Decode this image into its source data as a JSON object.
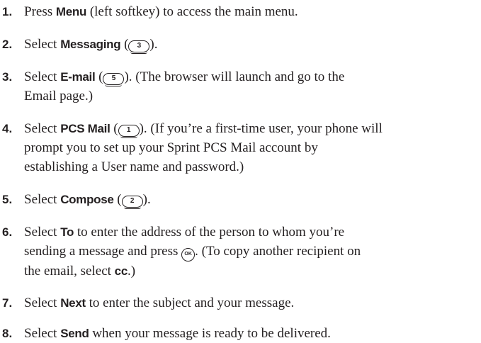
{
  "steps": [
    {
      "number": "1.",
      "lines": [
        [
          {
            "type": "text",
            "value": "Press "
          },
          {
            "type": "bold",
            "value": "Menu"
          },
          {
            "type": "text",
            "value": " (left softkey) to access the main menu."
          }
        ]
      ]
    },
    {
      "number": "2.",
      "lines": [
        [
          {
            "type": "text",
            "value": "Select "
          },
          {
            "type": "bold",
            "value": "Messaging"
          },
          {
            "type": "text",
            "value": " ("
          },
          {
            "type": "key",
            "value": "3"
          },
          {
            "type": "text",
            "value": ")."
          }
        ]
      ]
    },
    {
      "number": "3.",
      "lines": [
        [
          {
            "type": "text",
            "value": "Select "
          },
          {
            "type": "bold",
            "value": "E-mail"
          },
          {
            "type": "text",
            "value": " ("
          },
          {
            "type": "key",
            "value": "5"
          },
          {
            "type": "text",
            "value": "). (The browser will launch and go to the"
          }
        ],
        [
          {
            "type": "text",
            "value": "Email page.)"
          }
        ]
      ]
    },
    {
      "number": "4.",
      "lines": [
        [
          {
            "type": "text",
            "value": "Select "
          },
          {
            "type": "bold",
            "value": "PCS Mail"
          },
          {
            "type": "text",
            "value": " ("
          },
          {
            "type": "key",
            "value": "1"
          },
          {
            "type": "text",
            "value": "). (If you’re a first-time user, your phone will"
          }
        ],
        [
          {
            "type": "text",
            "value": "prompt you to set up your Sprint PCS Mail account by"
          }
        ],
        [
          {
            "type": "text",
            "value": "establishing a User name and password.)"
          }
        ]
      ]
    },
    {
      "number": "5.",
      "lines": [
        [
          {
            "type": "text",
            "value": "Select "
          },
          {
            "type": "bold",
            "value": "Compose"
          },
          {
            "type": "text",
            "value": " ("
          },
          {
            "type": "key",
            "value": "2"
          },
          {
            "type": "text",
            "value": ")."
          }
        ]
      ]
    },
    {
      "number": "6.",
      "lines": [
        [
          {
            "type": "text",
            "value": "Select "
          },
          {
            "type": "bold",
            "value": "To"
          },
          {
            "type": "text",
            "value": " to enter the address of the person to whom you’re"
          }
        ],
        [
          {
            "type": "text",
            "value": "sending a message and press "
          },
          {
            "type": "ok",
            "value": "OK"
          },
          {
            "type": "text",
            "value": ". (To copy another recipient on"
          }
        ],
        [
          {
            "type": "text",
            "value": "the email, select "
          },
          {
            "type": "bold",
            "value": "cc"
          },
          {
            "type": "text",
            "value": ".)"
          }
        ]
      ]
    },
    {
      "number": "7.",
      "lines": [
        [
          {
            "type": "text",
            "value": "Select "
          },
          {
            "type": "bold",
            "value": "Next"
          },
          {
            "type": "text",
            "value": " to enter the subject and your message."
          }
        ]
      ]
    },
    {
      "number": "8.",
      "lines": [
        [
          {
            "type": "text",
            "value": "Select "
          },
          {
            "type": "bold",
            "value": "Send"
          },
          {
            "type": "text",
            "value": " when your message is ready to be delivered."
          }
        ]
      ]
    }
  ]
}
